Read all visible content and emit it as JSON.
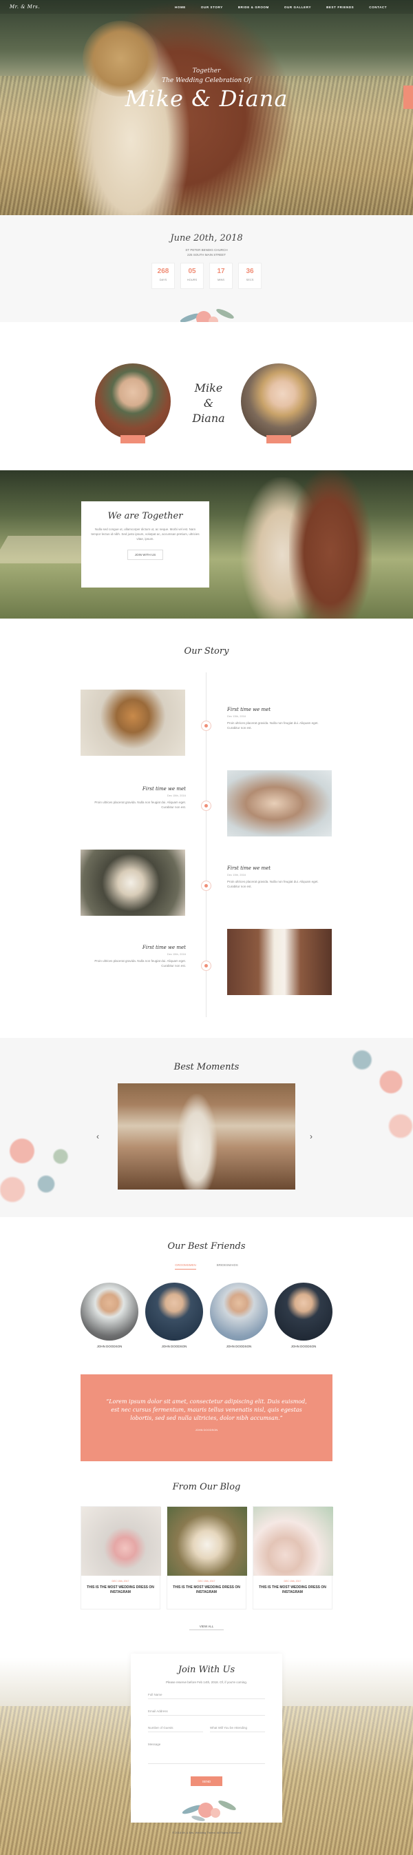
{
  "nav": {
    "logo": "Mr. & Mrs.",
    "items": [
      "HOME",
      "OUR STORY",
      "BRIDE & GROOM",
      "OUR GALLERY",
      "BEST FRIENDS",
      "CONTACT"
    ]
  },
  "hero": {
    "pre": "Together",
    "subtitle": "The Wedding Celebration Of",
    "names": "Mike & Diana"
  },
  "date": {
    "title": "June 20th, 2018",
    "address_line1": "ST PETER BENDIG CHURCH",
    "address_line2": "225 SOUTH MAIN STREET",
    "counters": [
      {
        "value": "268",
        "label": "DAYS"
      },
      {
        "value": "05",
        "label": "HOURS"
      },
      {
        "value": "17",
        "label": "MINS"
      },
      {
        "value": "36",
        "label": "SECS"
      }
    ]
  },
  "couple": {
    "groom_name": "Mike",
    "amp": "&",
    "bride_name": "Diana"
  },
  "together": {
    "title": "We are Together",
    "text": "Nulla sed congue ut, ullamcorper dictum ut, ac neque. Morbi vel est. Nam tempor lectus id nibh. Sed justo ipsum, volutpat ac, accumsan pretium, ultricies vitae, ipsum.",
    "button": "JOIN WITH US"
  },
  "story": {
    "title": "Our Story",
    "events": [
      {
        "title": "First time we met",
        "date": "Dec 15th, 2016",
        "text": "Proin ultrices placerat gravida. Nulla non feugiat dui. Aliquam eget. Curabitur non est."
      },
      {
        "title": "First time we met",
        "date": "Dec 15th, 2016",
        "text": "Proin ultrices placerat gravida. Nulla non feugiat dui. Aliquam eget. Curabitur non est."
      },
      {
        "title": "First time we met",
        "date": "Dec 15th, 2016",
        "text": "Proin ultrices placerat gravida. Nulla non feugiat dui. Aliquam eget. Curabitur non est."
      },
      {
        "title": "First time we met",
        "date": "Dec 15th, 2016",
        "text": "Proin ultrices placerat gravida. Nulla non feugiat dui. Aliquam eget. Curabitur non est."
      }
    ]
  },
  "moments": {
    "title": "Best Moments",
    "prev": "‹",
    "next": "›"
  },
  "friends": {
    "title": "Our Best Friends",
    "tabs": [
      "GROOMSMEN",
      "BRIDESMAIDS"
    ],
    "people": [
      "JOHN DOODSON",
      "JOHN DOODSON",
      "JOHN DOODSON",
      "JOHN DOODSON"
    ]
  },
  "quote": {
    "text": "“Lorem ipsum dolor sit amet, consectetur adipiscing elit. Duis euismod, est nec cursus fermentum, mauris tellus venenatis nisl, quis egestas lobortis, sed sed nulla ultricies, dolor nibh accumsan.”",
    "author": "JOHN DOODSON"
  },
  "blog": {
    "title": "From Our Blog",
    "posts": [
      {
        "date": "DEC 15th, 2017",
        "title": "THIS IS THE MOST WEDDING DRESS ON INSTAGRAM"
      },
      {
        "date": "DEC 15th, 2017",
        "title": "THIS IS THE MOST WEDDING DRESS ON INSTAGRAM"
      },
      {
        "date": "DEC 15th, 2017",
        "title": "THIS IS THE MOST WEDDING DRESS ON INSTAGRAM"
      }
    ],
    "view_all": "VIEW ALL"
  },
  "join": {
    "title": "Join With Us",
    "subtitle": "Please reserve before Feb 14th, 2018. Of, if you're coming.",
    "fields": {
      "full_name": "Full Name",
      "email": "Email Address",
      "guests": "Number of Guests",
      "event": "What Will You be Attending",
      "message": "Message"
    },
    "send": "SEND",
    "copyright": "© 2018 Mr. & Mrs. Wedding Theme. All Rights Reserved"
  },
  "colors": {
    "accent": "#f08e77",
    "background_light": "#f7f7f7"
  }
}
